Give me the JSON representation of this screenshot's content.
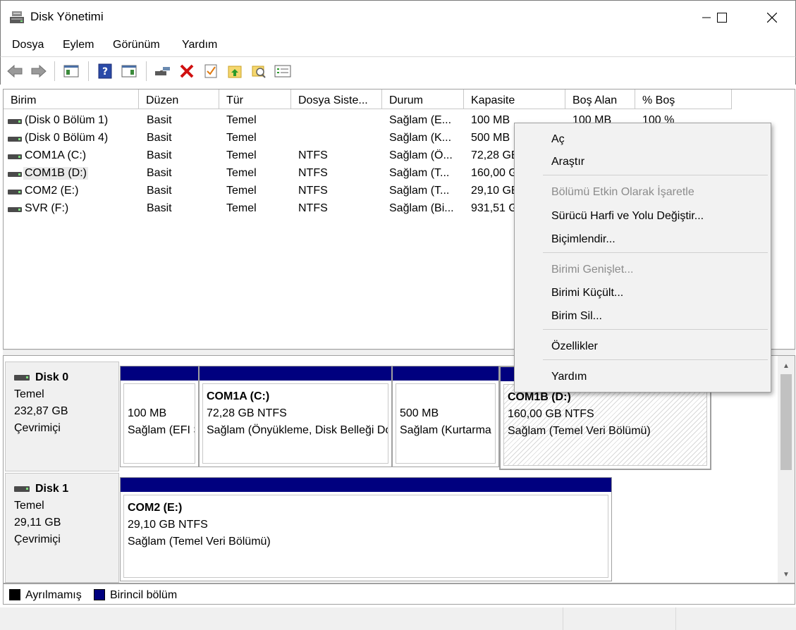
{
  "window": {
    "title": "Disk Yönetimi",
    "icon": "disk-management-icon"
  },
  "menu": [
    "Dosya",
    "Eylem",
    "Görünüm",
    "Yardım"
  ],
  "list": {
    "columns": [
      "Birim",
      "Düzen",
      "Tür",
      "Dosya Siste...",
      "Durum",
      "Kapasite",
      "Boş Alan",
      "% Boş"
    ],
    "rows": [
      {
        "birim": "(Disk 0 Bölüm 1)",
        "duzen": "Basit",
        "tur": "Temel",
        "fs": "",
        "durum": "Sağlam (E...",
        "kapasite": "100 MB",
        "bos": "100 MB",
        "yuzde": "100 %"
      },
      {
        "birim": "(Disk 0 Bölüm 4)",
        "duzen": "Basit",
        "tur": "Temel",
        "fs": "",
        "durum": "Sağlam (K...",
        "kapasite": "500 MB",
        "bos": "",
        "yuzde": ""
      },
      {
        "birim": "COM1A (C:)",
        "duzen": "Basit",
        "tur": "Temel",
        "fs": "NTFS",
        "durum": "Sağlam (Ö...",
        "kapasite": "72,28 GB",
        "bos": "",
        "yuzde": ""
      },
      {
        "birim": "COM1B (D:)",
        "duzen": "Basit",
        "tur": "Temel",
        "fs": "NTFS",
        "durum": "Sağlam (T...",
        "kapasite": "160,00 GB",
        "bos": "",
        "yuzde": ""
      },
      {
        "birim": "COM2 (E:)",
        "duzen": "Basit",
        "tur": "Temel",
        "fs": "NTFS",
        "durum": "Sağlam (T...",
        "kapasite": "29,10 GB",
        "bos": "",
        "yuzde": ""
      },
      {
        "birim": "SVR (F:)",
        "duzen": "Basit",
        "tur": "Temel",
        "fs": "NTFS",
        "durum": "Sağlam (Bi...",
        "kapasite": "931,51 GB",
        "bos": "",
        "yuzde": ""
      }
    ]
  },
  "disks": [
    {
      "name": "Disk 0",
      "type": "Temel",
      "size": "232,87 GB",
      "state": "Çevrimiçi",
      "partitions": [
        {
          "title": "",
          "line1": "100 MB",
          "line2": "Sağlam (EFI Sistem Bölümü)"
        },
        {
          "title": "COM1A  (C:)",
          "line1": "72,28 GB NTFS",
          "line2": "Sağlam (Önyükleme, Disk Belleği Dosyası)"
        },
        {
          "title": "",
          "line1": "500 MB",
          "line2": "Sağlam (Kurtarma Bölümü)"
        },
        {
          "title": "COM1B  (D:)",
          "line1": "160,00 GB NTFS",
          "line2": "Sağlam (Temel Veri Bölümü)"
        }
      ]
    },
    {
      "name": "Disk 1",
      "type": "Temel",
      "size": "29,11 GB",
      "state": "Çevrimiçi",
      "partitions": [
        {
          "title": "COM2  (E:)",
          "line1": "29,10 GB NTFS",
          "line2": "Sağlam (Temel Veri Bölümü)"
        }
      ]
    }
  ],
  "legend": [
    {
      "label": "Ayrılmamış",
      "color": "#000000"
    },
    {
      "label": "Birincil bölüm",
      "color": "#00007f"
    }
  ],
  "context_menu": [
    {
      "label": "Aç",
      "enabled": true
    },
    {
      "label": "Araştır",
      "enabled": true
    },
    {
      "label": "Bölümü Etkin Olarak İşaretle",
      "enabled": false
    },
    {
      "label": "Sürücü Harfi ve Yolu Değiştir...",
      "enabled": true
    },
    {
      "label": "Biçimlendir...",
      "enabled": true
    },
    {
      "label": "Birimi Genişlet...",
      "enabled": false
    },
    {
      "label": "Birimi Küçült...",
      "enabled": true
    },
    {
      "label": "Birim Sil...",
      "enabled": true
    },
    {
      "label": "Özellikler",
      "enabled": true
    },
    {
      "label": "Yardım",
      "enabled": true
    }
  ],
  "colors": {
    "primary_partition": "#00007f",
    "disabled_text": "#8c8c8c"
  }
}
